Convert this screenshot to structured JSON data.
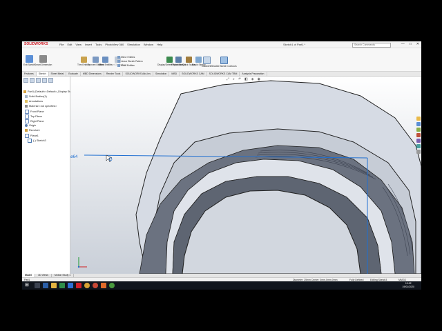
{
  "app": {
    "logo": "SOLIDWORKS",
    "doc_title": "Sketch1 of Part1 *",
    "search_placeholder": "Search Commands"
  },
  "menu": [
    "File",
    "Edit",
    "View",
    "Insert",
    "Tools",
    "PhotoView 360",
    "Simulation",
    "Window",
    "Help"
  ],
  "window_buttons": [
    "—",
    "□",
    "✕"
  ],
  "ribbon": {
    "exit_sketch": "Exit Sketch",
    "smart_dimension": "Smart Dimension",
    "trim": "Trim Entities",
    "convert": "Convert Entities",
    "offset": "Offset Entities",
    "offset_surface": "Offset On Surface",
    "mirror": "Mirror Entities",
    "linear_pattern": "Linear Sketch Pattern",
    "move": "Move Entities",
    "display_delete": "Display/Delete Relations",
    "repair": "Repair Sketch",
    "quick_snaps": "Quick Snaps",
    "rapid_sketch": "Rapid Sketch",
    "instant2d": "Instant2D",
    "shaded_contours": "Shaded Sketch Contours"
  },
  "tabs": [
    "Features",
    "Sketch",
    "Sheet Metal",
    "Evaluate",
    "MBD Dimensions",
    "Render Tools",
    "SOLIDWORKS Add-Ins",
    "Simulation",
    "MBD",
    "SOLIDWORKS CAM",
    "SOLIDWORKS CAM TBM",
    "Analysis Preparation"
  ],
  "tree": {
    "root": "Part1 (Default<<Default>_Display State 1>)",
    "items": [
      "Solid Bodies(1)",
      "Annotations",
      "Material <not specified>",
      "Front Plane",
      "Top Plane",
      "Right Plane",
      "Origin",
      "Revolve1",
      "Plane1",
      "(-) Sketch3"
    ]
  },
  "viewport": {
    "dimension_label": "ø64"
  },
  "bottom_tabs": [
    "Model",
    "3D Views",
    "Motion Study 1"
  ],
  "status": {
    "left": "Part1",
    "info": "Diameter: 25mm  Center: 0mm,0mm,0mm",
    "defined": "Fully Defined",
    "editing": "Editing Sketch3",
    "units": "MMGS"
  },
  "clock": {
    "time": "19:02",
    "date": "19/01/2020"
  }
}
